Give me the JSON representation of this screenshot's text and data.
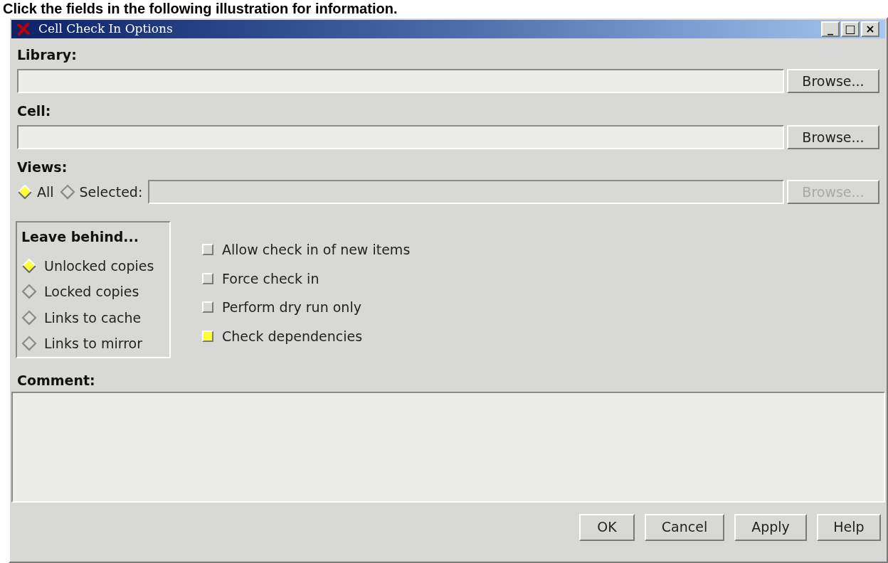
{
  "page_heading": "Click the fields in the following illustration for information.",
  "window": {
    "title": "Cell Check In Options",
    "controls": [
      "_",
      "□",
      "×"
    ]
  },
  "library": {
    "label": "Library:",
    "browse": {
      "label": "Browse...",
      "disabled": false
    }
  },
  "cell": {
    "label": "Cell:",
    "browse": {
      "label": "Browse...",
      "disabled": false
    }
  },
  "views": {
    "label": "Views:",
    "options": [
      {
        "label": "All",
        "selected": true
      },
      {
        "label": "Selected:",
        "selected": false
      }
    ],
    "field_disabled": true,
    "browse": {
      "label": "Browse...",
      "disabled": true
    }
  },
  "leave_behind": {
    "title": "Leave behind...",
    "options": [
      {
        "label": "Unlocked copies",
        "selected": true
      },
      {
        "label": "Locked copies",
        "selected": false
      },
      {
        "label": "Links to cache",
        "selected": false
      },
      {
        "label": "Links to mirror",
        "selected": false
      }
    ]
  },
  "checkboxes": [
    {
      "label": "Allow check in of new items",
      "checked": false
    },
    {
      "label": "Force check in",
      "checked": false
    },
    {
      "label": "Perform dry run only",
      "checked": false
    },
    {
      "label": "Check dependencies",
      "checked": true
    }
  ],
  "comment": {
    "label": "Comment:"
  },
  "buttons": [
    "OK",
    "Cancel",
    "Apply",
    "Help"
  ]
}
